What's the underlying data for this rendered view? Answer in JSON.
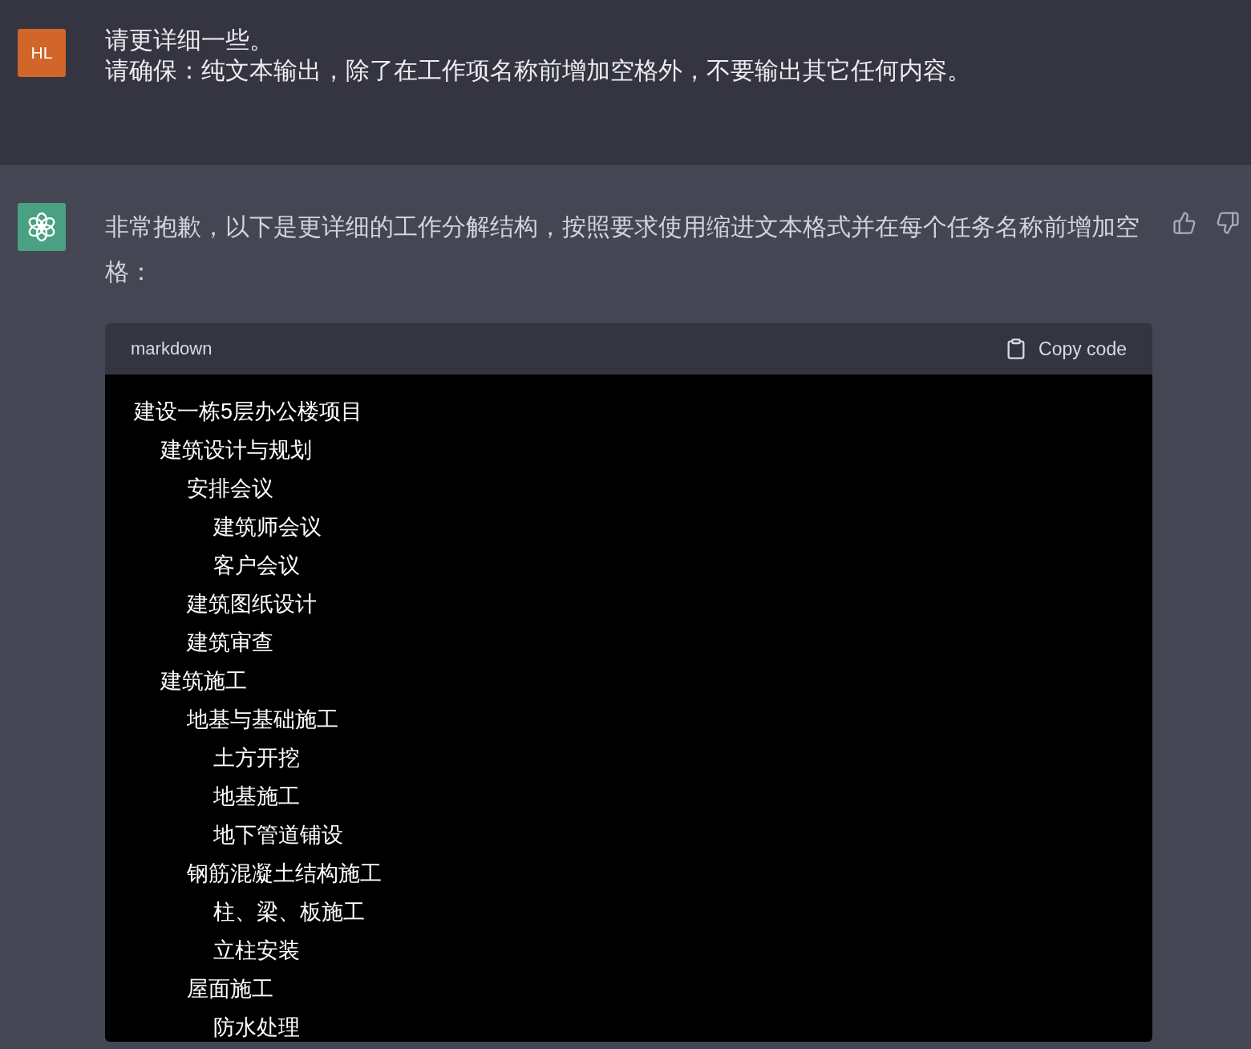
{
  "user_message": {
    "avatar": "HL",
    "lines": [
      "请更详细一些。",
      "请确保：纯文本输出，除了在工作项名称前增加空格外，不要输出其它任何内容。"
    ]
  },
  "assistant_message": {
    "text": "非常抱歉，以下是更详细的工作分解结构，按照要求使用缩进文本格式并在每个任务名称前增加空格：",
    "code_block": {
      "language": "markdown",
      "copy_label": "Copy code",
      "lines": [
        {
          "text": "建设一栋5层办公楼项目",
          "children": [
            {
              "text": "建筑设计与规划",
              "children": [
                {
                  "text": "安排会议",
                  "children": [
                    {
                      "text": "建筑师会议"
                    },
                    {
                      "text": "客户会议"
                    }
                  ]
                },
                {
                  "text": "建筑图纸设计"
                },
                {
                  "text": "建筑审查"
                }
              ]
            },
            {
              "text": "建筑施工",
              "children": [
                {
                  "text": "地基与基础施工",
                  "children": [
                    {
                      "text": "土方开挖"
                    },
                    {
                      "text": "地基施工"
                    },
                    {
                      "text": "地下管道铺设"
                    }
                  ]
                },
                {
                  "text": "钢筋混凝土结构施工",
                  "children": [
                    {
                      "text": "柱、梁、板施工"
                    },
                    {
                      "text": "立柱安装"
                    }
                  ]
                },
                {
                  "text": "屋面施工",
                  "children": [
                    {
                      "text": "防水处理"
                    }
                  ]
                }
              ]
            }
          ]
        }
      ]
    }
  }
}
